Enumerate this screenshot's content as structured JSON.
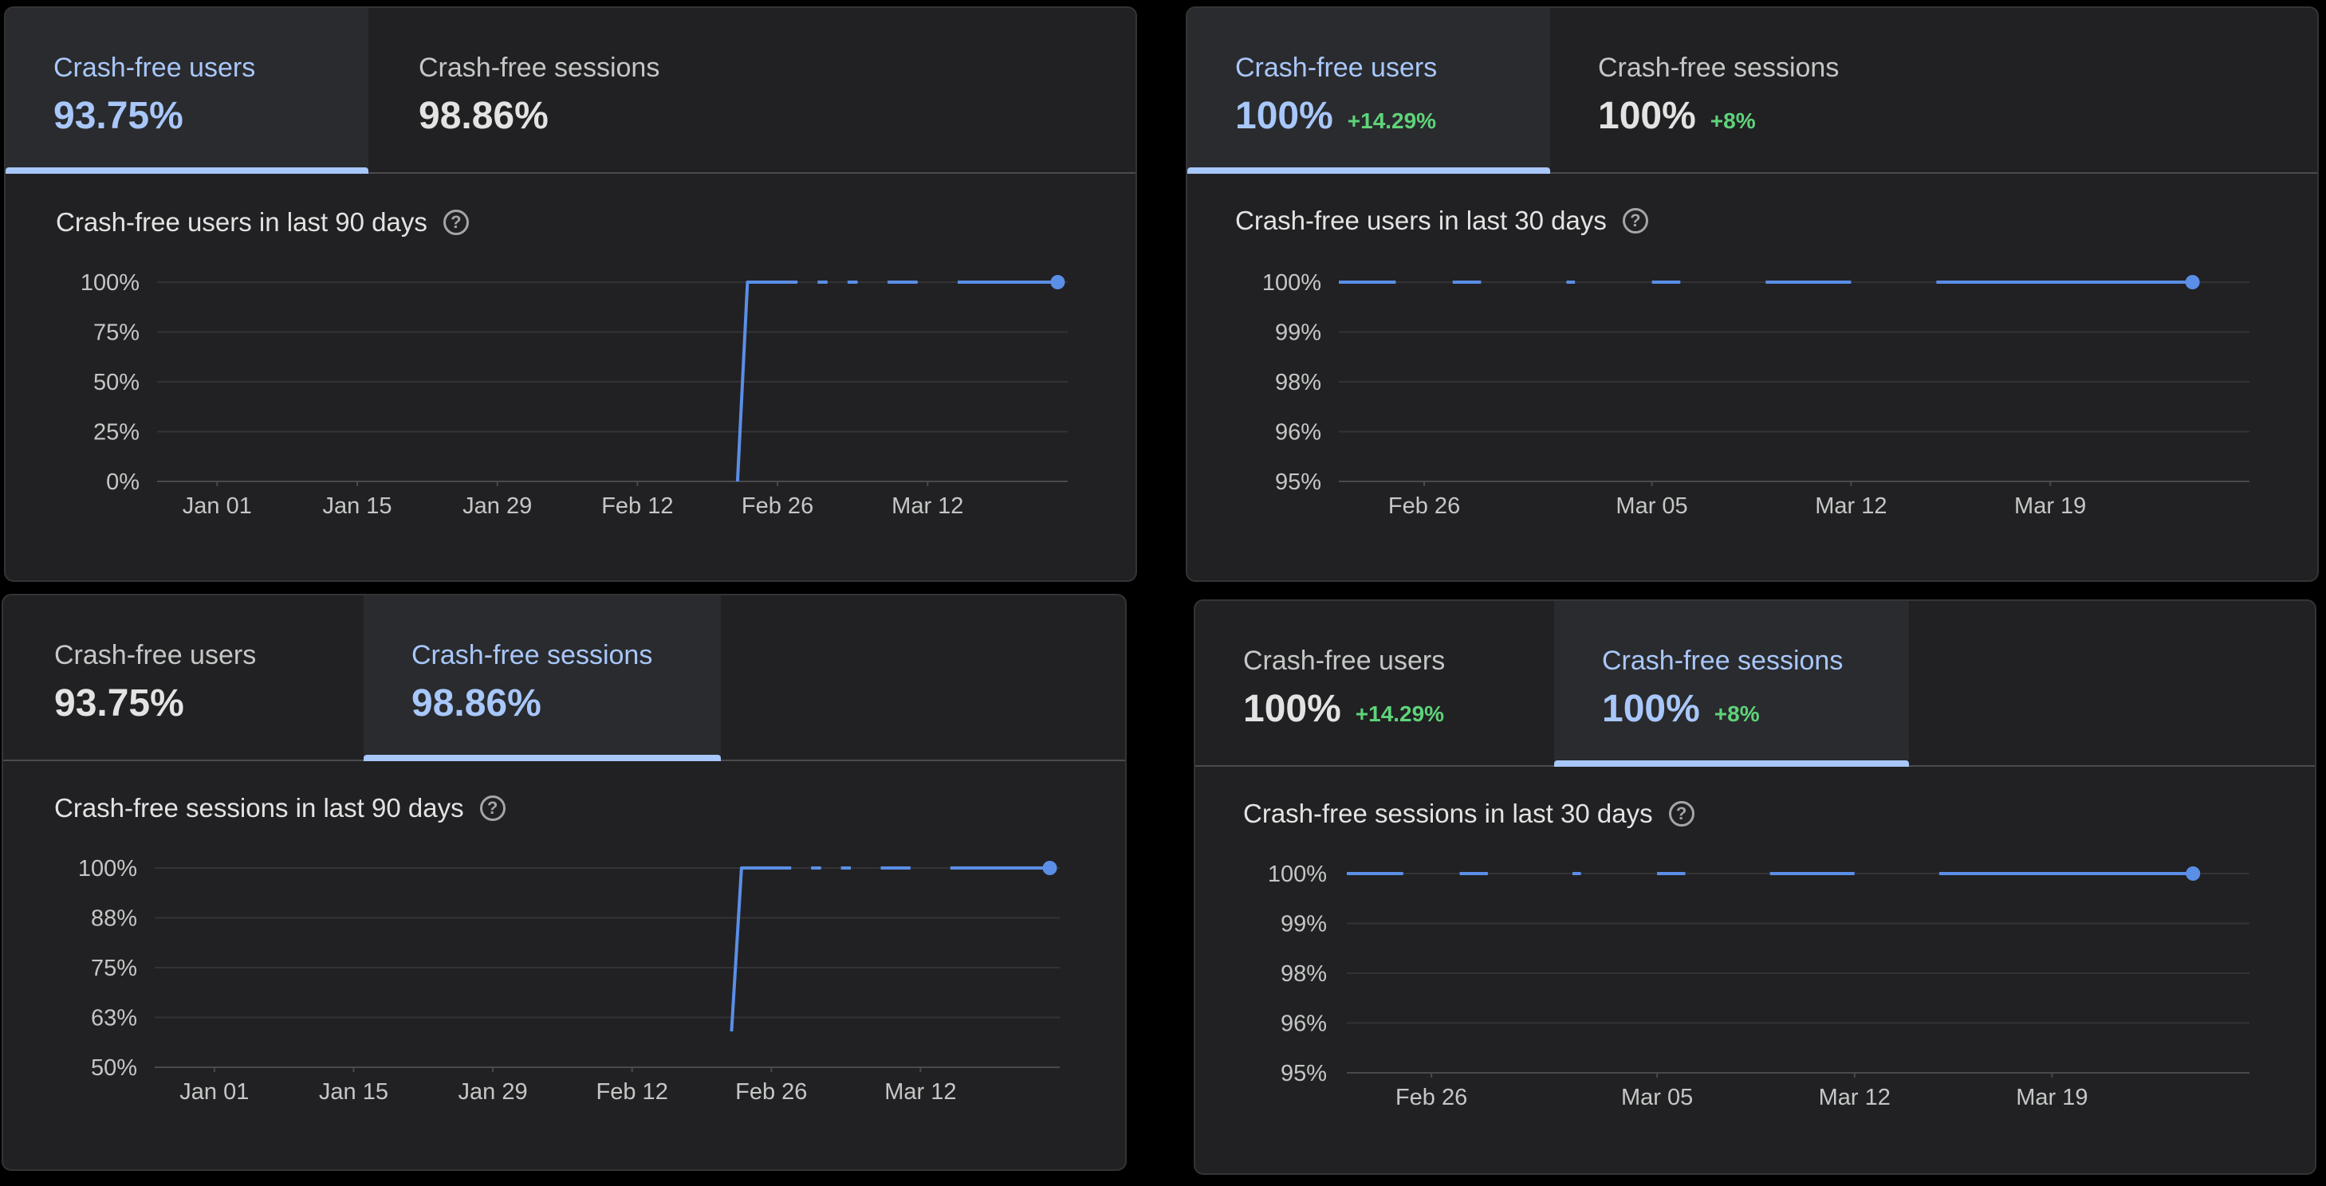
{
  "colors": {
    "accent": "#a8c7fa",
    "line": "#5b8ee6",
    "delta": "#5fd37a",
    "background": "#212123"
  },
  "panels": [
    {
      "tabs": [
        {
          "label": "Crash-free users",
          "value": "93.75%",
          "delta": "",
          "active": true
        },
        {
          "label": "Crash-free sessions",
          "value": "98.86%",
          "delta": "",
          "active": false
        }
      ],
      "chart_title": "Crash-free users in last 90 days",
      "help_icon": "help-circle-icon"
    },
    {
      "tabs": [
        {
          "label": "Crash-free users",
          "value": "100%",
          "delta": "+14.29%",
          "active": true
        },
        {
          "label": "Crash-free sessions",
          "value": "100%",
          "delta": "+8%",
          "active": false
        }
      ],
      "chart_title": "Crash-free users in last 30 days",
      "help_icon": "help-circle-icon"
    },
    {
      "tabs": [
        {
          "label": "Crash-free users",
          "value": "93.75%",
          "delta": "",
          "active": false
        },
        {
          "label": "Crash-free sessions",
          "value": "98.86%",
          "delta": "",
          "active": true
        }
      ],
      "chart_title": "Crash-free sessions in last 90 days",
      "help_icon": "help-circle-icon"
    },
    {
      "tabs": [
        {
          "label": "Crash-free users",
          "value": "100%",
          "delta": "+14.29%",
          "active": false
        },
        {
          "label": "Crash-free sessions",
          "value": "100%",
          "delta": "+8%",
          "active": true
        }
      ],
      "chart_title": "Crash-free sessions in last 30 days",
      "help_icon": "help-circle-icon"
    }
  ],
  "chart_data": [
    {
      "type": "line",
      "title": "Crash-free users in last 90 days",
      "x_range": [
        "2023-12-26",
        "2024-03-26"
      ],
      "y_ticks": [
        "0%",
        "25%",
        "50%",
        "75%",
        "100%"
      ],
      "y_tick_values": [
        0,
        25,
        50,
        75,
        100
      ],
      "ylim": [
        0,
        100
      ],
      "x_tick_labels": [
        "Jan 01",
        "Jan 15",
        "Jan 29",
        "Feb 12",
        "Feb 26",
        "Mar 12"
      ],
      "x_tick_dates": [
        "2024-01-01",
        "2024-01-15",
        "2024-01-29",
        "2024-02-12",
        "2024-02-26",
        "2024-03-12"
      ],
      "segments": [
        [
          [
            "2024-02-22",
            0
          ],
          [
            "2024-02-23",
            100
          ],
          [
            "2024-02-28",
            100
          ]
        ],
        [
          [
            "2024-03-01",
            100
          ],
          [
            "2024-03-02",
            100
          ]
        ],
        [
          [
            "2024-03-04",
            100
          ],
          [
            "2024-03-05",
            100
          ]
        ],
        [
          [
            "2024-03-08",
            100
          ],
          [
            "2024-03-11",
            100
          ]
        ],
        [
          [
            "2024-03-15",
            100
          ],
          [
            "2024-03-25",
            100
          ]
        ]
      ],
      "last_point": [
        "2024-03-25",
        100
      ],
      "grid": true
    },
    {
      "type": "line",
      "title": "Crash-free users in last 30 days",
      "x_range": [
        "2024-02-23",
        "2024-03-26"
      ],
      "y_ticks": [
        "95%",
        "96%",
        "98%",
        "99%",
        "100%"
      ],
      "y_tick_values": [
        95,
        96,
        98,
        99,
        100
      ],
      "ylim": [
        95,
        100
      ],
      "x_tick_labels": [
        "Feb 26",
        "Mar 05",
        "Mar 12",
        "Mar 19"
      ],
      "x_tick_dates": [
        "2024-02-26",
        "2024-03-05",
        "2024-03-12",
        "2024-03-19"
      ],
      "segments": [
        [
          [
            "2024-02-23",
            100
          ],
          [
            "2024-02-25",
            100
          ]
        ],
        [
          [
            "2024-02-27",
            100
          ],
          [
            "2024-02-28",
            100
          ]
        ],
        [
          [
            "2024-03-02",
            100
          ],
          [
            "2024-03-02.3",
            100
          ]
        ],
        [
          [
            "2024-03-05",
            100
          ],
          [
            "2024-03-06",
            100
          ]
        ],
        [
          [
            "2024-03-09",
            100
          ],
          [
            "2024-03-12",
            100
          ]
        ],
        [
          [
            "2024-03-15",
            100
          ],
          [
            "2024-03-24",
            100
          ]
        ]
      ],
      "last_point": [
        "2024-03-24",
        100
      ],
      "grid": true
    },
    {
      "type": "line",
      "title": "Crash-free sessions in last 90 days",
      "x_range": [
        "2023-12-26",
        "2024-03-26"
      ],
      "y_ticks": [
        "50%",
        "63%",
        "75%",
        "88%",
        "100%"
      ],
      "y_tick_values": [
        50,
        62.5,
        75,
        87.5,
        100
      ],
      "ylim": [
        50,
        100
      ],
      "x_tick_labels": [
        "Jan 01",
        "Jan 15",
        "Jan 29",
        "Feb 12",
        "Feb 26",
        "Mar 12"
      ],
      "x_tick_dates": [
        "2024-01-01",
        "2024-01-15",
        "2024-01-29",
        "2024-02-12",
        "2024-02-26",
        "2024-03-12"
      ],
      "segments": [
        [
          [
            "2024-02-22",
            59
          ],
          [
            "2024-02-23",
            100
          ],
          [
            "2024-02-28",
            100
          ]
        ],
        [
          [
            "2024-03-01",
            100
          ],
          [
            "2024-03-02",
            100
          ]
        ],
        [
          [
            "2024-03-04",
            100
          ],
          [
            "2024-03-05",
            100
          ]
        ],
        [
          [
            "2024-03-08",
            100
          ],
          [
            "2024-03-11",
            100
          ]
        ],
        [
          [
            "2024-03-15",
            100
          ],
          [
            "2024-03-25",
            100
          ]
        ]
      ],
      "last_point": [
        "2024-03-25",
        100
      ],
      "grid": true
    },
    {
      "type": "line",
      "title": "Crash-free sessions in last 30 days",
      "x_range": [
        "2024-02-23",
        "2024-03-26"
      ],
      "y_ticks": [
        "95%",
        "96%",
        "98%",
        "99%",
        "100%"
      ],
      "y_tick_values": [
        95,
        96,
        98,
        99,
        100
      ],
      "ylim": [
        95,
        100
      ],
      "x_tick_labels": [
        "Feb 26",
        "Mar 05",
        "Mar 12",
        "Mar 19"
      ],
      "x_tick_dates": [
        "2024-02-26",
        "2024-03-05",
        "2024-03-12",
        "2024-03-19"
      ],
      "segments": [
        [
          [
            "2024-02-23",
            100
          ],
          [
            "2024-02-25",
            100
          ]
        ],
        [
          [
            "2024-02-27",
            100
          ],
          [
            "2024-02-28",
            100
          ]
        ],
        [
          [
            "2024-03-02",
            100
          ],
          [
            "2024-03-02.3",
            100
          ]
        ],
        [
          [
            "2024-03-05",
            100
          ],
          [
            "2024-03-06",
            100
          ]
        ],
        [
          [
            "2024-03-09",
            100
          ],
          [
            "2024-03-12",
            100
          ]
        ],
        [
          [
            "2024-03-15",
            100
          ],
          [
            "2024-03-24",
            100
          ]
        ]
      ],
      "last_point": [
        "2024-03-24",
        100
      ],
      "grid": true
    }
  ]
}
